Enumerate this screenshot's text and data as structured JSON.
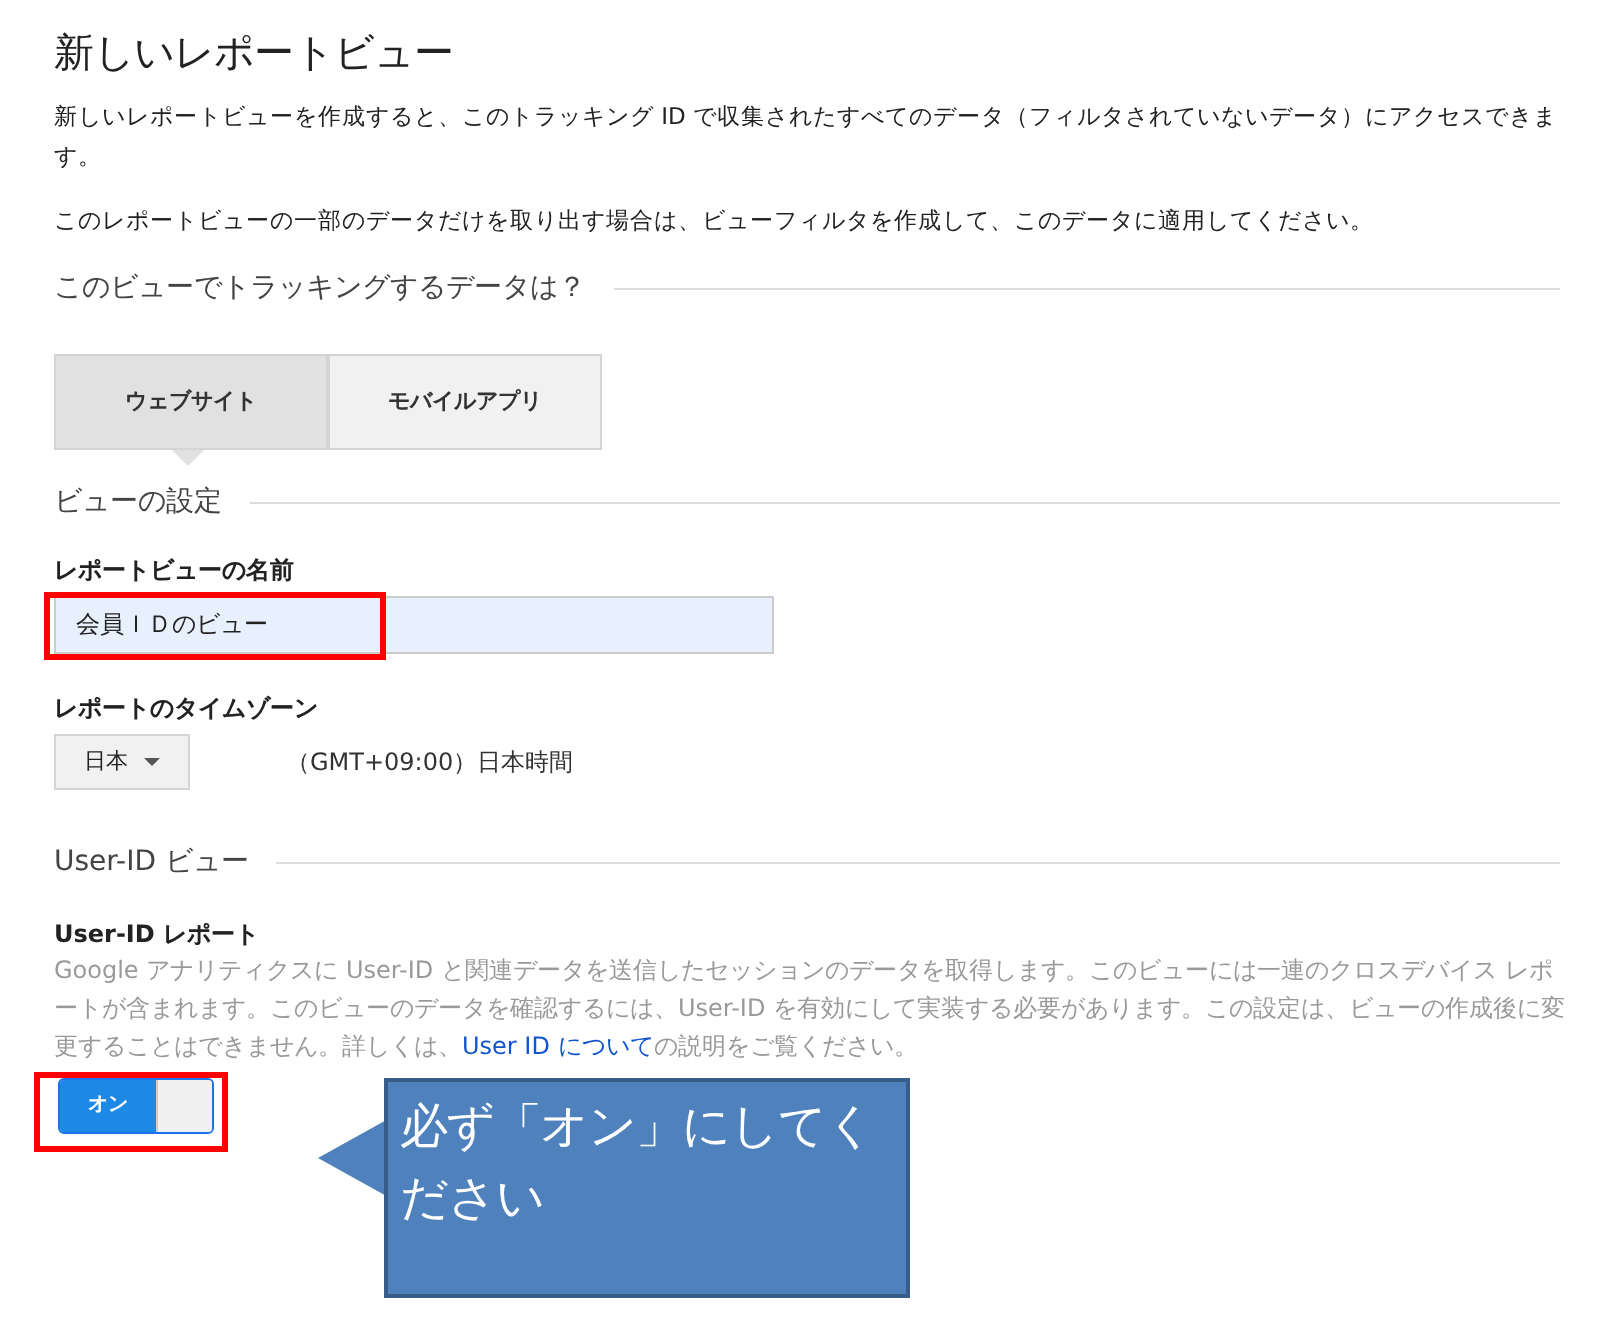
{
  "title": "新しいレポートビュー",
  "intro": [
    "新しいレポートビューを作成すると、このトラッキング ID で収集されたすべてのデータ（フィルタされていないデータ）にアクセスできます。",
    "このレポートビューの一部のデータだけを取り出す場合は、ビューフィルタを作成して、このデータに適用してください。"
  ],
  "tracking_section": {
    "heading": "このビューでトラッキングするデータは？",
    "tabs": [
      {
        "label": "ウェブサイト",
        "selected": true
      },
      {
        "label": "モバイルアプリ",
        "selected": false
      }
    ]
  },
  "settings_section": {
    "heading": "ビューの設定",
    "name_label": "レポートビューの名前",
    "name_value": "会員ＩＤのビュー",
    "timezone_label": "レポートのタイムゾーン",
    "country": "日本",
    "timezone": "（GMT+09:00）日本時間"
  },
  "userid_section": {
    "heading": "User-ID ビュー",
    "report_label": "User-ID レポート",
    "description": {
      "before": "Google アナリティクスに User-ID と関連データを送信したセッションのデータを取得します。このビューには一連のクロスデバイス レポートが含まれます。このビューのデータを確認するには、User-ID を有効にして実装する必要があります。この設定は、ビューの作成後に変更することはできません。詳しくは、",
      "link": "User ID について",
      "after": "の説明をご覧ください。"
    },
    "toggle": {
      "label": "オン",
      "on": true
    }
  },
  "callout": "必ず「オン」にしてください"
}
